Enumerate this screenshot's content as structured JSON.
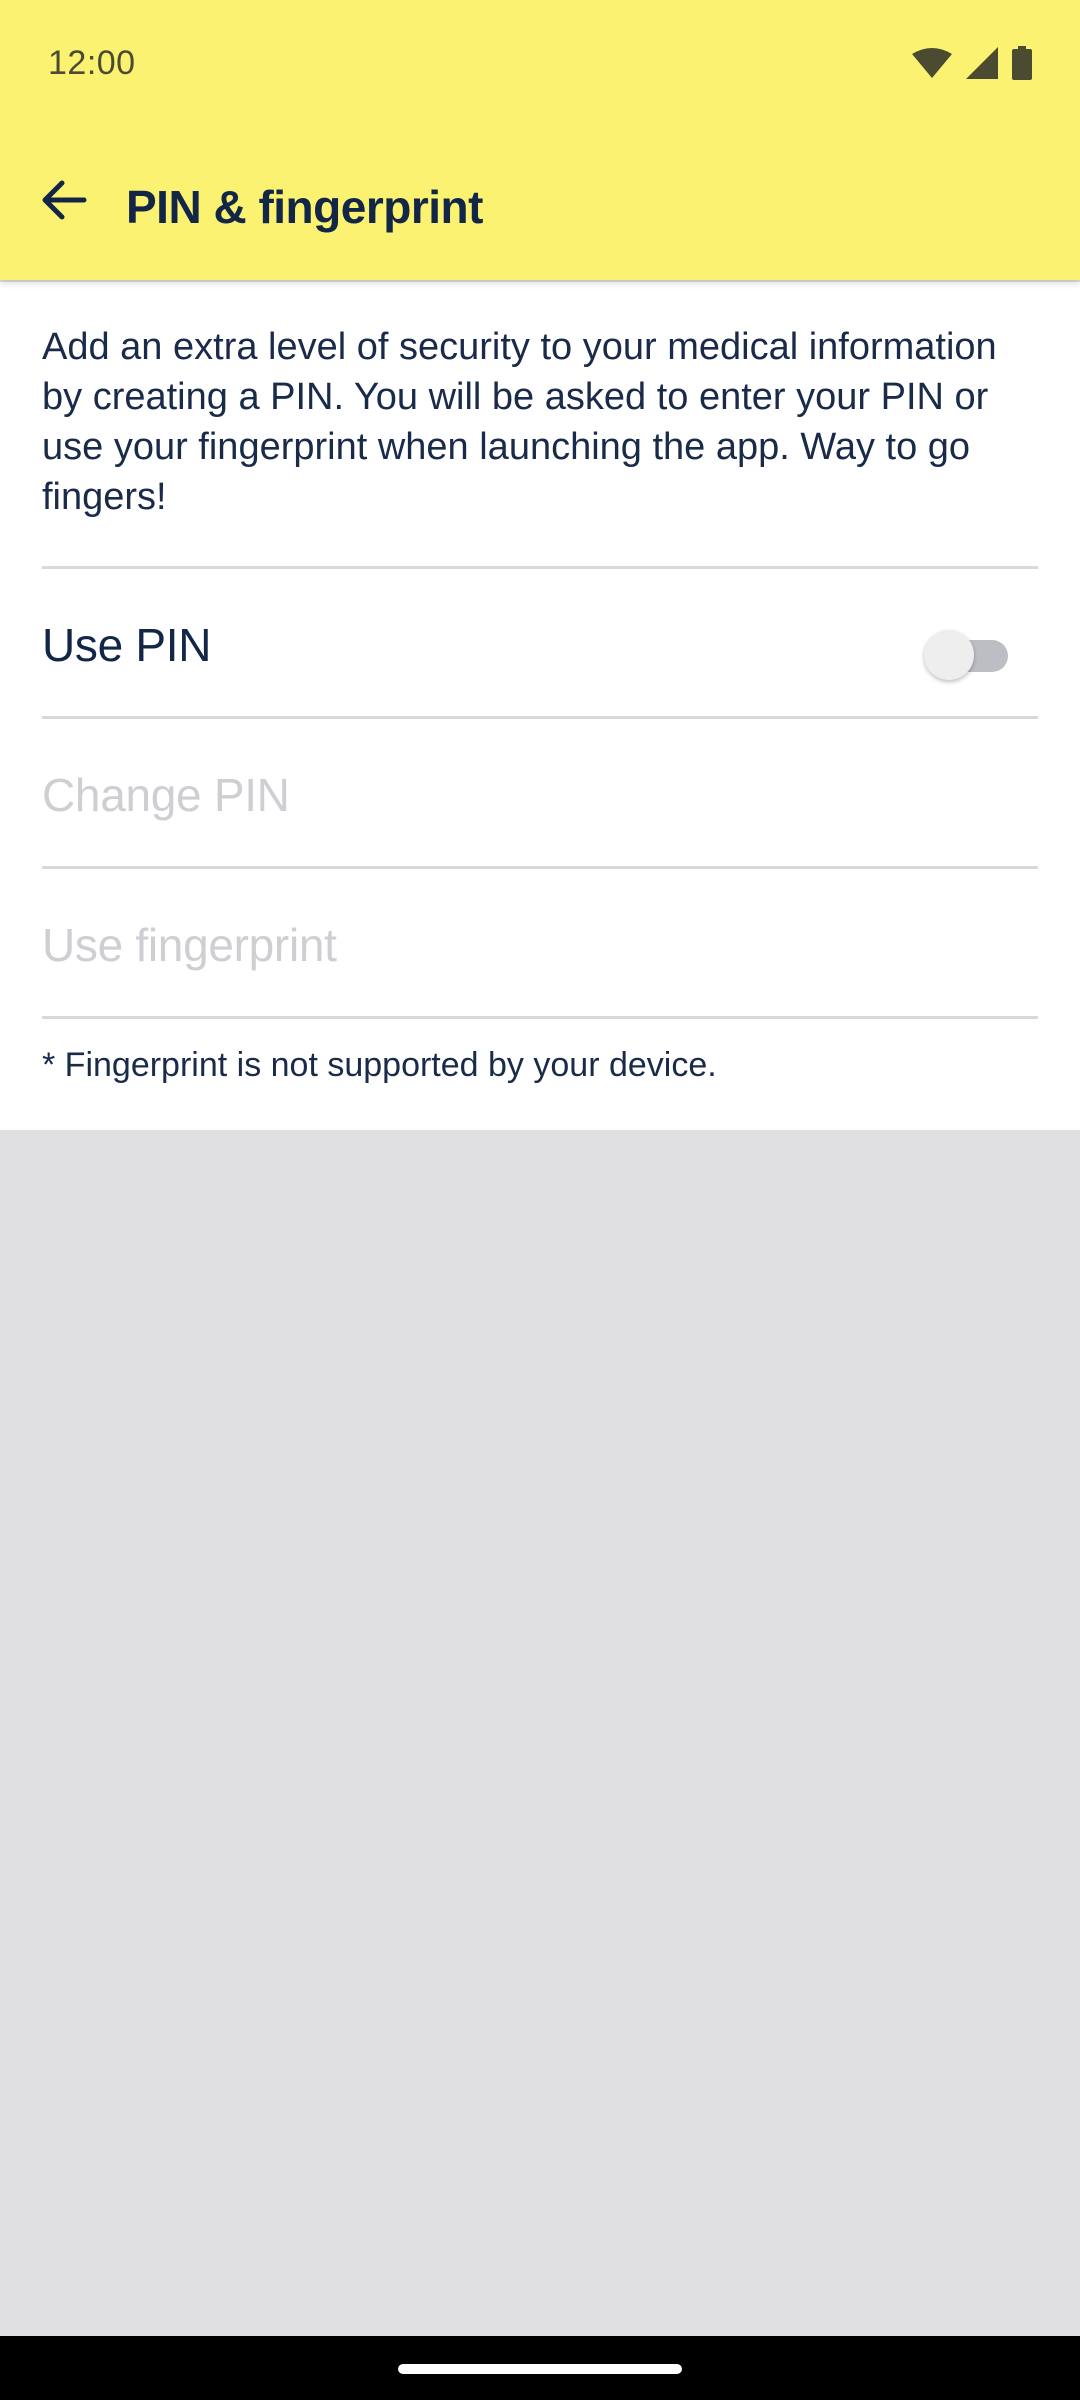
{
  "status_bar": {
    "time": "12:00",
    "icons": [
      "wifi-icon",
      "cell-signal-icon",
      "battery-icon"
    ]
  },
  "app_bar": {
    "back_icon": "arrow-back-icon",
    "title": "PIN & fingerprint"
  },
  "content": {
    "intro": "Add an extra level of security to your medical information by creating a PIN. You will be asked to enter your PIN or use your fingerprint when launching the app. Way to go fingers!",
    "use_pin_label": "Use PIN",
    "use_pin_enabled": false,
    "change_pin_label": "Change PIN",
    "use_fingerprint_label": "Use fingerprint",
    "footnote": "* Fingerprint is not supported by your device."
  },
  "colors": {
    "header_background": "#fbf272",
    "primary_text": "#122647",
    "disabled_text": "#cfcfd3",
    "page_background": "#e0e0e2"
  }
}
